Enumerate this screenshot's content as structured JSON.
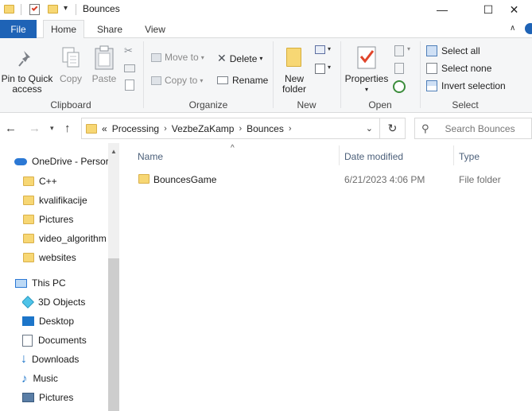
{
  "window": {
    "title": "Bounces",
    "minimize_glyph": "—",
    "maximize_glyph": "☐",
    "close_glyph": "✕"
  },
  "ribbon_tabs": [
    {
      "label": "File"
    },
    {
      "label": "Home"
    },
    {
      "label": "Share"
    },
    {
      "label": "View"
    }
  ],
  "ribbon": {
    "clipboard": {
      "group_label": "Clipboard",
      "pin_label_1": "Pin to Quick",
      "pin_label_2": "access",
      "copy": "Copy",
      "paste": "Paste"
    },
    "organize": {
      "group_label": "Organize",
      "move_to": "Move to",
      "copy_to": "Copy to",
      "delete": "Delete",
      "rename": "Rename"
    },
    "new": {
      "group_label": "New",
      "new_folder_1": "New",
      "new_folder_2": "folder"
    },
    "open": {
      "group_label": "Open",
      "properties": "Properties"
    },
    "select": {
      "group_label": "Select",
      "select_all": "Select all",
      "select_none": "Select none",
      "invert_selection": "Invert selection"
    }
  },
  "address_bar": {
    "overflow": "«",
    "crumbs": [
      "Processing",
      "VezbeZaKamp",
      "Bounces"
    ],
    "search_placeholder": "Search Bounces"
  },
  "nav_pane": {
    "onedrive": "OneDrive - Persor",
    "onedrive_folders": [
      "C++",
      "kvalifikacije",
      "Pictures",
      "video_algorithm",
      "websites"
    ],
    "this_pc": "This PC",
    "pc_items": [
      {
        "label": "3D Objects",
        "icon": "3d-objects-icon"
      },
      {
        "label": "Desktop",
        "icon": "desktop-icon"
      },
      {
        "label": "Documents",
        "icon": "documents-icon"
      },
      {
        "label": "Downloads",
        "icon": "downloads-icon"
      },
      {
        "label": "Music",
        "icon": "music-icon"
      },
      {
        "label": "Pictures",
        "icon": "pictures-icon"
      }
    ]
  },
  "file_list": {
    "columns": [
      "Name",
      "Date modified",
      "Type"
    ],
    "rows": [
      {
        "name": "BouncesGame",
        "date": "6/21/2023 4:06 PM",
        "type": "File folder"
      }
    ]
  },
  "colors": {
    "file_tab": "#1e63b6",
    "folder_yellow": "#f7d774",
    "header_text": "#4c607a"
  }
}
